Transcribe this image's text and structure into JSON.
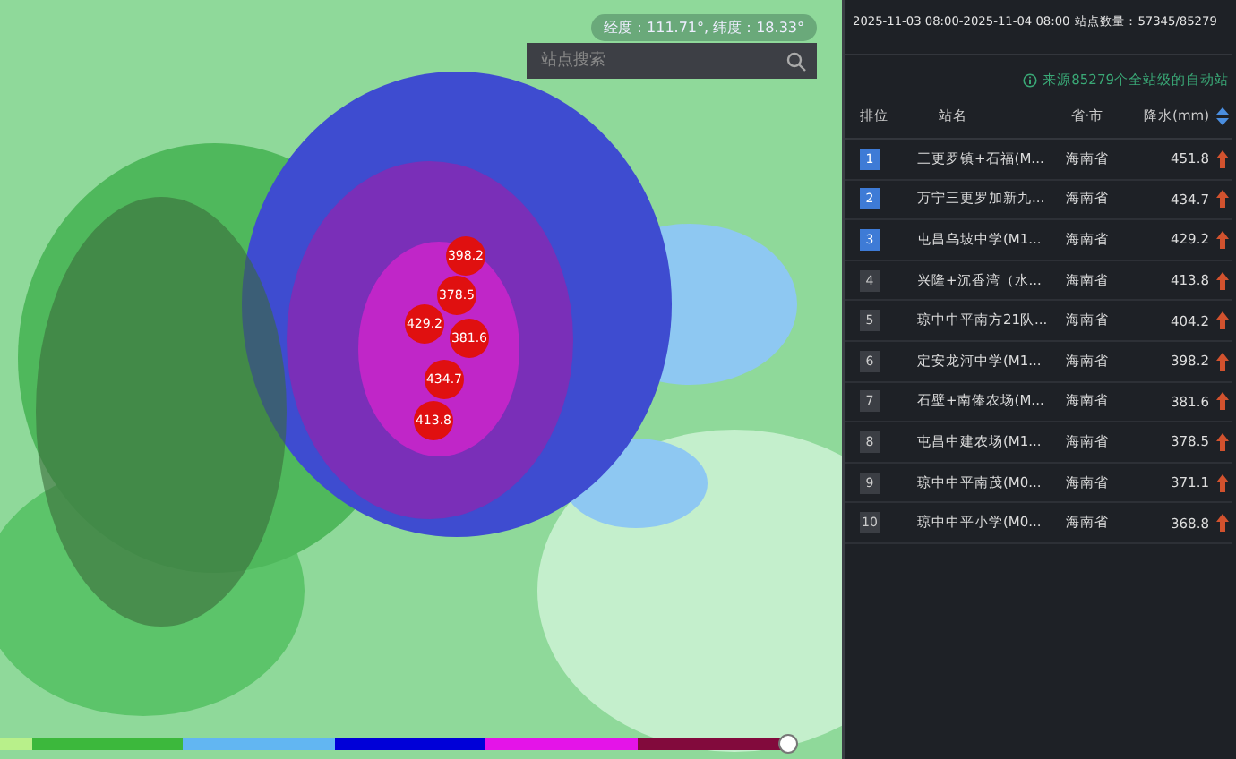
{
  "map": {
    "coordinates": "经度：111.71°, 纬度：18.33°",
    "search": {
      "placeholder": "站点搜索"
    },
    "markers": [
      {
        "label": "398.2"
      },
      {
        "label": "378.5"
      },
      {
        "label": "429.2"
      },
      {
        "label": "381.6"
      },
      {
        "label": "434.7"
      },
      {
        "label": "413.8"
      }
    ],
    "legend": {
      "level": 1.0
    }
  },
  "panel": {
    "period": "2025-11-03 08:00-2025-11-04 08:00",
    "station_count": "站点数量：57345/85279",
    "source": "来源85279个全站级的自动站",
    "columns": [
      "排位",
      "站名",
      "省·市",
      "降水(mm)"
    ],
    "rows": [
      {
        "rank": "1",
        "name": "三更罗镇+石福(M...",
        "province": "海南省",
        "value": "451.8"
      },
      {
        "rank": "2",
        "name": "万宁三更罗加新九...",
        "province": "海南省",
        "value": "434.7"
      },
      {
        "rank": "3",
        "name": "屯昌乌坡中学(M1...",
        "province": "海南省",
        "value": "429.2"
      },
      {
        "rank": "4",
        "name": "兴隆+沉香湾（水...",
        "province": "海南省",
        "value": "413.8"
      },
      {
        "rank": "5",
        "name": "琼中中平南方21队...",
        "province": "海南省",
        "value": "404.2"
      },
      {
        "rank": "6",
        "name": "定安龙河中学(M1...",
        "province": "海南省",
        "value": "398.2"
      },
      {
        "rank": "7",
        "name": "石壁+南俸农场(M...",
        "province": "海南省",
        "value": "381.6"
      },
      {
        "rank": "8",
        "name": "屯昌中建农场(M1...",
        "province": "海南省",
        "value": "378.5"
      },
      {
        "rank": "9",
        "name": "琼中中平南茂(M0...",
        "province": "海南省",
        "value": "371.1"
      },
      {
        "rank": "10",
        "name": "琼中中平小学(M0...",
        "province": "海南省",
        "value": "368.8"
      }
    ]
  }
}
